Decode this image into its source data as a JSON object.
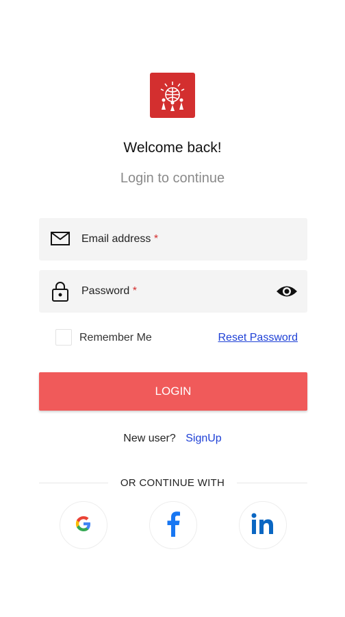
{
  "header": {
    "title": "Welcome back!",
    "subtitle": "Login to continue"
  },
  "form": {
    "email_label": "Email address",
    "password_label": "Password",
    "required_mark": "*",
    "remember_label": "Remember Me",
    "reset_label": "Reset Password",
    "login_label": "LOGIN"
  },
  "signup": {
    "prompt": "New user?",
    "link": "SignUp"
  },
  "social": {
    "divider_text": "OR CONTINUE WITH",
    "providers": [
      "google-icon",
      "facebook-icon",
      "linkedin-icon"
    ]
  },
  "colors": {
    "brand": "#d32f2f",
    "button": "#f05a5a",
    "link": "#1e40d6",
    "facebook": "#1877f2",
    "linkedin": "#0a66c2"
  }
}
